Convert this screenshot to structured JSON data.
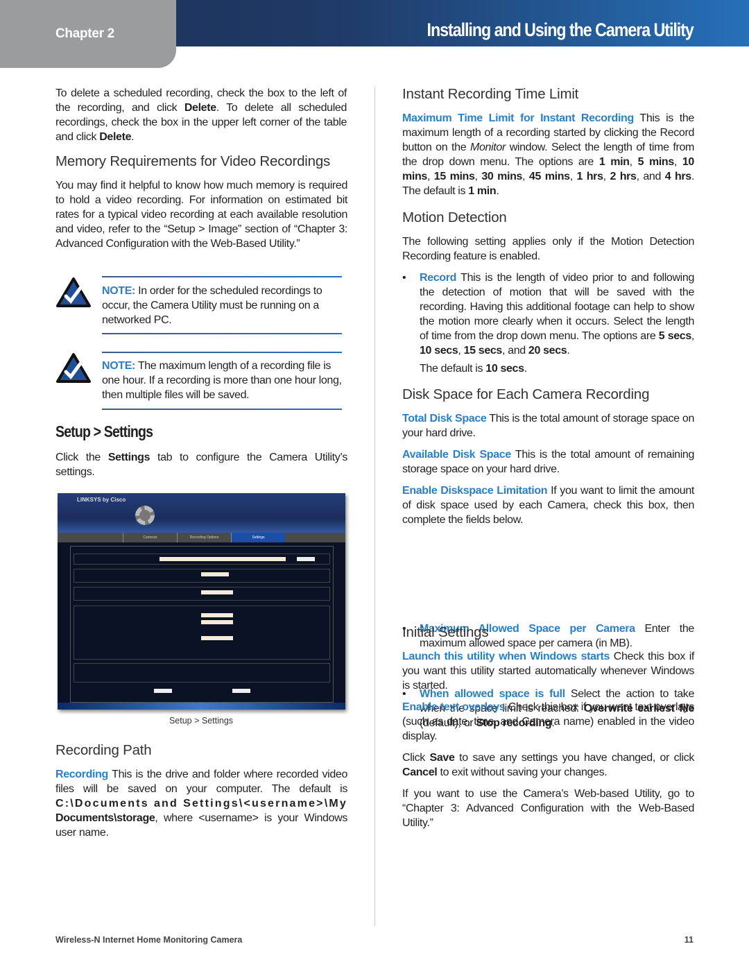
{
  "header": {
    "chapter": "Chapter 2",
    "title": "Installing and Using the Camera Utility",
    "accent": "#2a7fc6"
  },
  "left": {
    "p_delete": [
      {
        "t": "To delete a scheduled recording, check the box to the left of the recording, and click "
      },
      {
        "t": "Delete",
        "s": "b"
      },
      {
        "t": ". To delete all scheduled recordings, check the box in the upper left corner of the table and click "
      },
      {
        "t": "Delete",
        "s": "b"
      },
      {
        "t": "."
      }
    ],
    "h_memory": "Memory Requirements for Video Recordings",
    "p_memory": [
      {
        "t": "You may find it helpful to know how much memory is required to hold a video recording. For information on estimated bit rates for a typical video recording at each available resolution and video, refer to the “Setup > Image” section of “Chapter 3: Advanced Configuration with the Web-Based Utility.”"
      }
    ],
    "notes": [
      {
        "label": "NOTE:",
        "text": " In order for the scheduled recordings to occur, the Camera Utility must be running on a networked PC."
      },
      {
        "label": "NOTE:",
        "text": " The maximum length of a recording file is one hour. If a recording is more than one hour long, then multiple files will be saved."
      }
    ],
    "h_setup": "Setup > Settings",
    "p_setup": [
      {
        "t": "Click the "
      },
      {
        "t": "Settings",
        "s": "b"
      },
      {
        "t": " tab to configure the Camera Utility’s settings."
      }
    ],
    "screenshot": {
      "brand": "LINKSYS by Cisco",
      "tabs": [
        "Cameras",
        "Recording Options",
        "Settings"
      ],
      "active_tab": "Settings"
    },
    "caption": "Setup > Settings",
    "h_path": "Recording Path",
    "p_path": [
      {
        "t": "Recording",
        "s": "l"
      },
      {
        "t": "  This is the drive and folder where recorded video files will be saved on your computer. The default is "
      },
      {
        "t": "C:\\Documents and Settings\\<username>\\My",
        "s": "m"
      },
      {
        "t": " "
      },
      {
        "t": "Documents\\storage",
        "s": "b"
      },
      {
        "t": ", where <username> is your Windows user name."
      }
    ]
  },
  "right": {
    "h_instant": "Instant Recording Time Limit",
    "p_instant": [
      {
        "t": "Maximum Time Limit for Instant Recording",
        "s": "l"
      },
      {
        "t": "  This is the maximum length of a recording started by clicking the Record button on the "
      },
      {
        "t": "Monitor",
        "s": "i"
      },
      {
        "t": " window. Select the length of time from the drop down menu. The options are "
      },
      {
        "t": "1 min",
        "s": "b"
      },
      {
        "t": ", "
      },
      {
        "t": "5 mins",
        "s": "b"
      },
      {
        "t": ", "
      },
      {
        "t": "10 mins",
        "s": "b"
      },
      {
        "t": ", "
      },
      {
        "t": "15 mins",
        "s": "b"
      },
      {
        "t": ", "
      },
      {
        "t": "30 mins",
        "s": "b"
      },
      {
        "t": ", "
      },
      {
        "t": "45 mins",
        "s": "b"
      },
      {
        "t": ", "
      },
      {
        "t": "1 hrs",
        "s": "b"
      },
      {
        "t": ", "
      },
      {
        "t": "2 hrs",
        "s": "b"
      },
      {
        "t": ", and "
      },
      {
        "t": "4 hrs",
        "s": "b"
      },
      {
        "t": ". The default is "
      },
      {
        "t": "1 min",
        "s": "b"
      },
      {
        "t": "."
      }
    ],
    "h_motion": "Motion Detection",
    "p_motion": [
      {
        "t": "The following setting applies only if the Motion Detection Recording feature is enabled."
      }
    ],
    "b_record": [
      {
        "t": "Record",
        "s": "l"
      },
      {
        "t": "  This is the length of video prior to and following the detection of motion that will be saved with the recording. Having this additional footage can help to show the motion more clearly when it occurs. Select the length of time from the drop down menu. The options are "
      },
      {
        "t": "5 secs",
        "s": "b"
      },
      {
        "t": ", "
      },
      {
        "t": "10 secs",
        "s": "b"
      },
      {
        "t": ", "
      },
      {
        "t": "15 secs",
        "s": "b"
      },
      {
        "t": ", and "
      },
      {
        "t": "20 secs",
        "s": "b"
      },
      {
        "t": "."
      }
    ],
    "b_record_default": [
      {
        "t": "The default is "
      },
      {
        "t": "10 secs",
        "s": "b"
      },
      {
        "t": "."
      }
    ],
    "h_disk": "Disk Space for Each Camera Recording",
    "p_total": [
      {
        "t": "Total Disk Space",
        "s": "l"
      },
      {
        "t": "  This is the total amount of storage space on your hard drive."
      }
    ],
    "p_avail": [
      {
        "t": "Available Disk Space",
        "s": "l"
      },
      {
        "t": "  This is the total amount of remaining storage space on your hard drive."
      }
    ],
    "p_enable": [
      {
        "t": "Enable Diskspace Limitation",
        "s": "l"
      },
      {
        "t": "  If you want to limit the amount of disk space used by each Camera, check this box, then complete the fields below."
      }
    ],
    "b_max": [
      {
        "t": "Maximum Allowed Space per Camera",
        "s": "l"
      },
      {
        "t": "  Enter the maximum allowed space per camera (in MB)."
      }
    ],
    "b_full": [
      {
        "t": "When allowed space is full",
        "s": "l"
      },
      {
        "t": "  Select the action to take when the space limit is reached: "
      },
      {
        "t": "Overwrite earliest file",
        "s": "b"
      },
      {
        "t": " (default), or "
      },
      {
        "t": "Stop recording",
        "s": "b"
      },
      {
        "t": "."
      }
    ],
    "h_initial": "Initial Settings",
    "p_launch": [
      {
        "t": "Launch this utility when Windows starts",
        "s": "l"
      },
      {
        "t": "  Check this box if you want this utility started automatically whenever Windows is started."
      }
    ],
    "p_overlay": [
      {
        "t": "Enable text overlays",
        "s": "l"
      },
      {
        "t": "  Check this box if you want text overlays (such as date, time, and Camera name) enabled in the video display."
      }
    ],
    "p_save": [
      {
        "t": "Click "
      },
      {
        "t": "Save",
        "s": "b"
      },
      {
        "t": " to save any settings you have changed, or click "
      },
      {
        "t": "Cancel",
        "s": "b"
      },
      {
        "t": " to exit without saving your changes."
      }
    ],
    "p_web": [
      {
        "t": "If you want to use the Camera’s Web-based Utility, go to “Chapter 3: Advanced Configuration with the Web-Based Utility.”"
      }
    ]
  },
  "footer": {
    "product": "Wireless-N Internet Home Monitoring Camera",
    "page": "11"
  }
}
